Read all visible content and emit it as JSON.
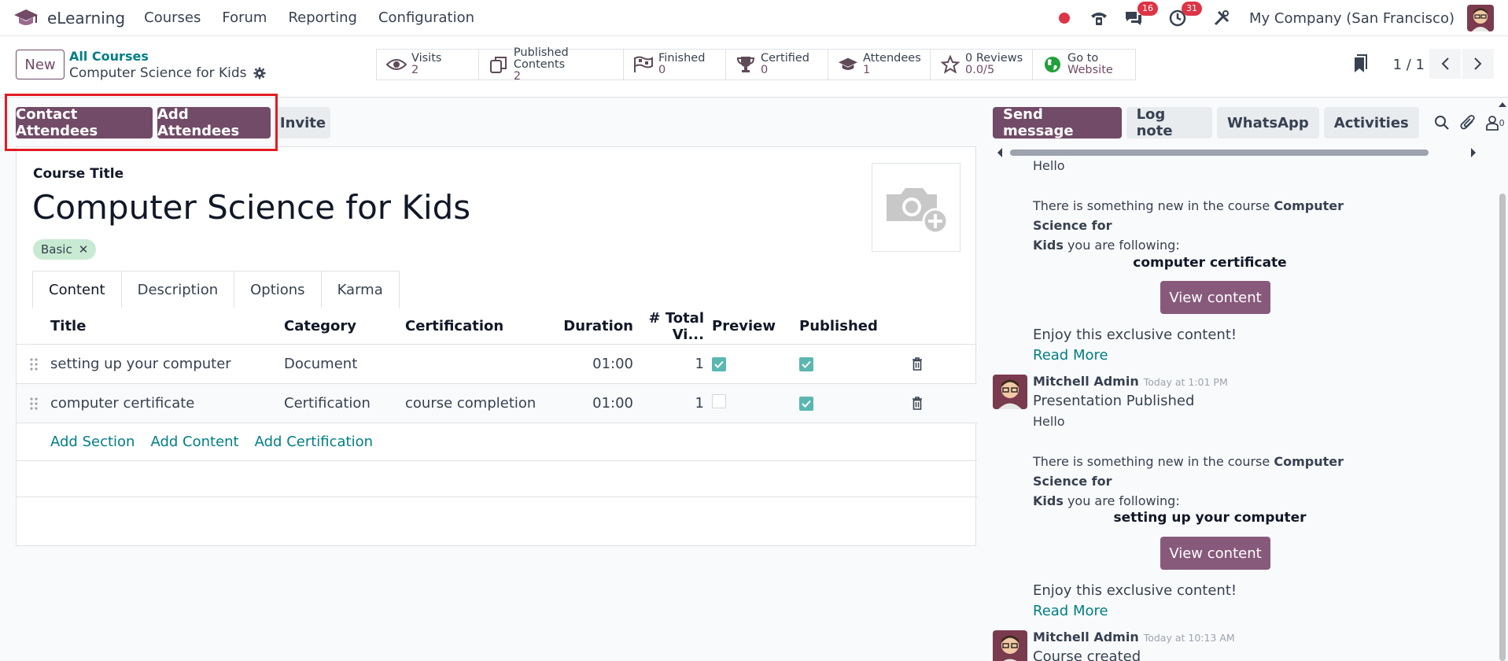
{
  "navbar": {
    "app_name": "eLearning",
    "menu": [
      "Courses",
      "Forum",
      "Reporting",
      "Configuration"
    ],
    "messages_badge": "16",
    "activities_badge": "31",
    "company": "My Company (San Francisco)"
  },
  "control_panel": {
    "new_label": "New",
    "breadcrumb_parent": "All Courses",
    "breadcrumb_current": "Computer Science for Kids",
    "stats": [
      {
        "label": "Visits",
        "value": "2",
        "icon": "eye-icon"
      },
      {
        "label": "Published Contents",
        "value": "2",
        "icon": "copy-icon"
      },
      {
        "label": "Finished",
        "value": "0",
        "icon": "flag-checkered-icon"
      },
      {
        "label": "Certified",
        "value": "0",
        "icon": "trophy-icon"
      },
      {
        "label": "Attendees",
        "value": "1",
        "icon": "graduation-cap-icon"
      },
      {
        "label": "0 Reviews",
        "value": "0.0/5",
        "icon": "star-icon"
      },
      {
        "label": "Go to",
        "value": "Website",
        "icon": "globe-icon"
      }
    ],
    "pager": "1 / 1"
  },
  "actions": {
    "contact": "Contact Attendees",
    "add": "Add Attendees",
    "invite": "Invite"
  },
  "form": {
    "title_label": "Course Title",
    "title": "Computer Science for Kids",
    "tag": "Basic",
    "tabs": [
      "Content",
      "Description",
      "Options",
      "Karma"
    ],
    "columns": {
      "title": "Title",
      "category": "Category",
      "certification": "Certification",
      "duration": "Duration",
      "total_views": "# Total Vi...",
      "preview": "Preview",
      "published": "Published"
    },
    "rows": [
      {
        "title": "setting up your computer",
        "category": "Document",
        "certification": "",
        "duration": "01:00",
        "views": "1",
        "preview": true,
        "published": true
      },
      {
        "title": "computer certificate",
        "category": "Certification",
        "certification": "course completion",
        "duration": "01:00",
        "views": "1",
        "preview": false,
        "published": true
      }
    ],
    "add_links": {
      "section": "Add Section",
      "content": "Add Content",
      "certification": "Add Certification"
    }
  },
  "chatter": {
    "send_message": "Send message",
    "log_note": "Log note",
    "whatsapp": "WhatsApp",
    "activities": "Activities",
    "followers_count": "0",
    "m1": {
      "hello": "Hello",
      "intro_pre": "There is something new in the course ",
      "course_bold_1": "Computer Science for",
      "course_bold_2": "Kids",
      "intro_post": " you are following:",
      "content_name": "computer certificate",
      "view_btn": "View content",
      "enjoy": "Enjoy this exclusive content!",
      "read_more": "Read More"
    },
    "m2": {
      "author": "Mitchell Admin",
      "time": "Today at 1:01 PM",
      "subject": "Presentation Published",
      "hello": "Hello",
      "intro_pre": "There is something new in the course ",
      "course_bold_1": "Computer Science for",
      "course_bold_2": "Kids",
      "intro_post": " you are following:",
      "content_name": "setting up your computer",
      "view_btn": "View content",
      "enjoy": "Enjoy this exclusive content!",
      "read_more": "Read More"
    },
    "m3": {
      "author": "Mitchell Admin",
      "time": "Today at 10:13 AM",
      "subject": "Course created"
    }
  },
  "colors": {
    "brand": "#714b67",
    "link": "#017e84",
    "highlight": "#e31b23"
  }
}
